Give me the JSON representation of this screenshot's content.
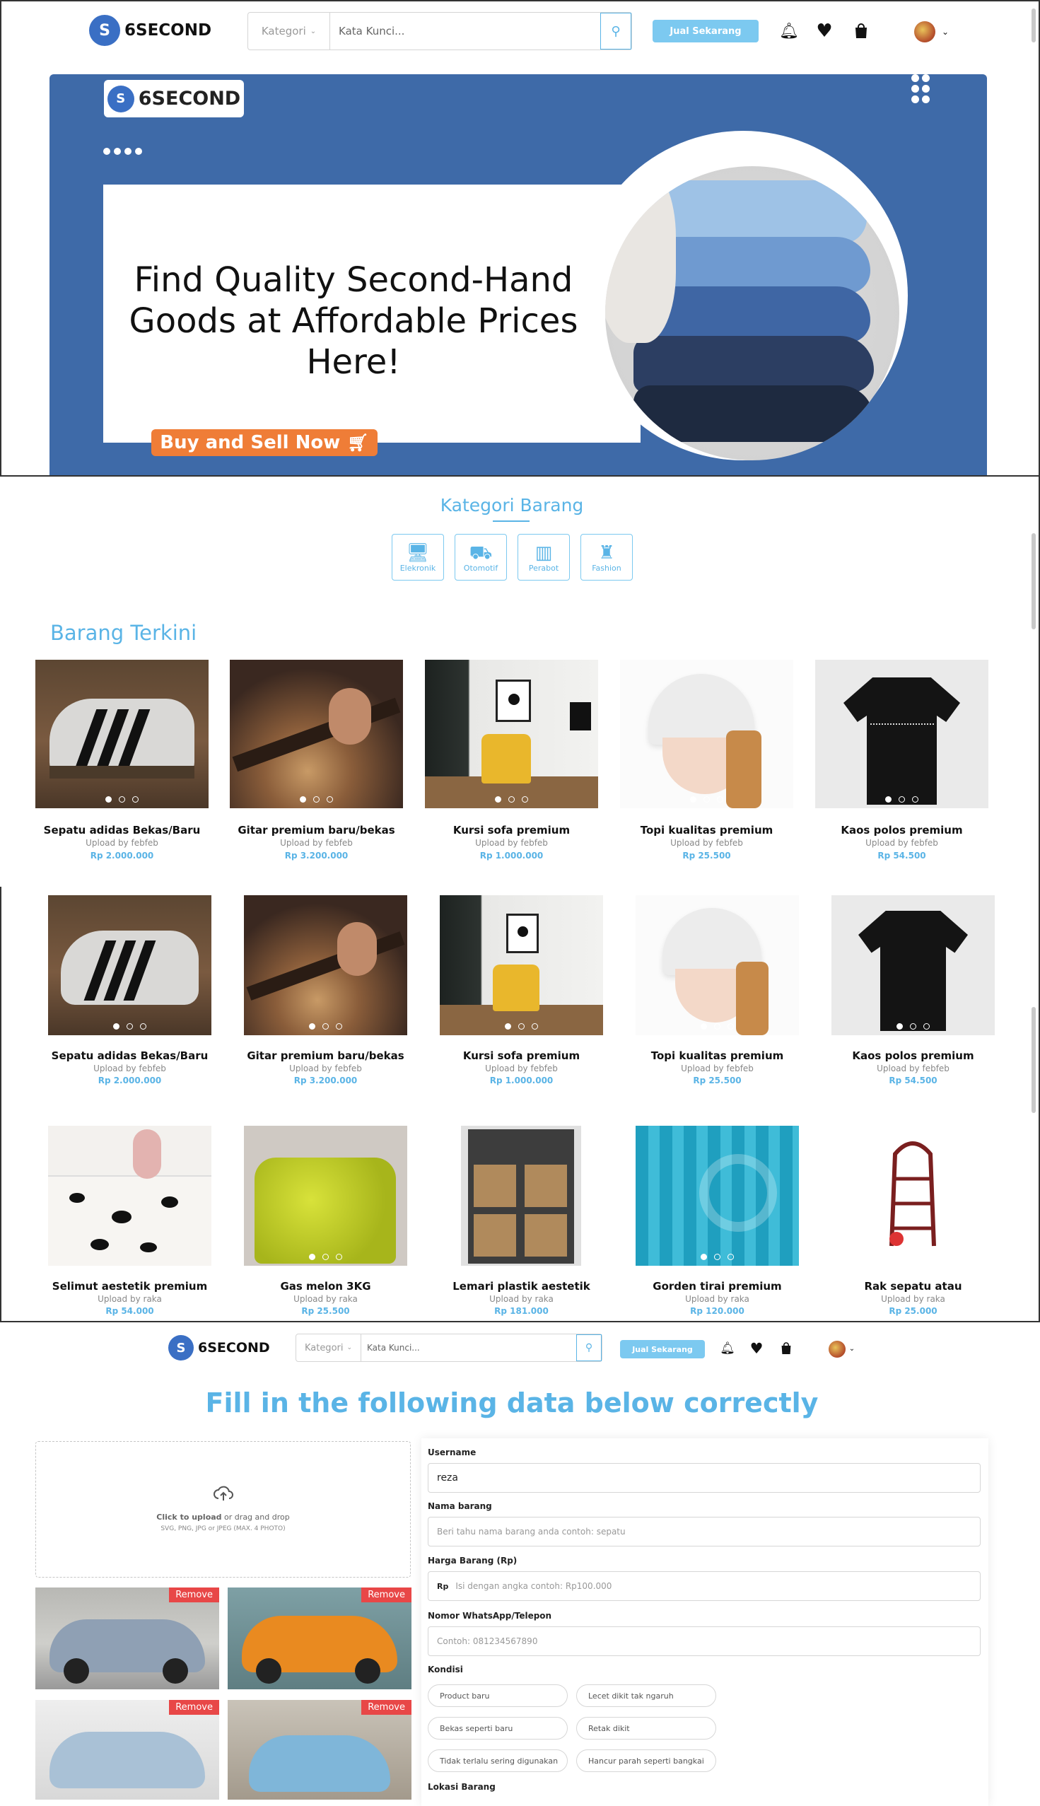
{
  "navbar": {
    "brand": "6SECOND",
    "category_placeholder": "Kategori",
    "keyword_placeholder": "Kata Kunci...",
    "sell_label": "Jual Sekarang"
  },
  "hero": {
    "logo_text": "6SECOND",
    "title": "Find Quality Second-Hand Goods at Affordable Prices Here!",
    "cta": "Buy and Sell Now"
  },
  "categories": {
    "title": "Kategori Barang",
    "items": [
      {
        "label": "Elekronik",
        "icon": "monitor-icon"
      },
      {
        "label": "Otomotif",
        "icon": "truck-icon"
      },
      {
        "label": "Perabot",
        "icon": "furniture-icon"
      },
      {
        "label": "Fashion",
        "icon": "shirt-icon"
      }
    ]
  },
  "latest": {
    "title": "Barang Terkini",
    "products": [
      {
        "name": "Sepatu adidas Bekas/Baru",
        "uploader": "Upload by febfeb",
        "price": "Rp 2.000.000"
      },
      {
        "name": "Gitar premium baru/bekas",
        "uploader": "Upload by febfeb",
        "price": "Rp 3.200.000"
      },
      {
        "name": "Kursi sofa premium",
        "uploader": "Upload by febfeb",
        "price": "Rp 1.000.000"
      },
      {
        "name": "Topi kualitas premium",
        "uploader": "Upload by febfeb",
        "price": "Rp 25.500"
      },
      {
        "name": "Kaos polos premium",
        "uploader": "Upload by febfeb",
        "price": "Rp 54.500"
      }
    ],
    "more_products": [
      {
        "name": "Selimut aestetik premium",
        "uploader": "Upload by raka",
        "price": "Rp 54.000"
      },
      {
        "name": "Gas melon 3KG",
        "uploader": "Upload by raka",
        "price": "Rp 25.500"
      },
      {
        "name": "Lemari plastik aestetik",
        "uploader": "Upload by raka",
        "price": "Rp 181.000"
      },
      {
        "name": "Gorden tirai premium",
        "uploader": "Upload by raka",
        "price": "Rp 120.000"
      },
      {
        "name": "Rak sepatu atau",
        "uploader": "Upload by raka",
        "price": "Rp 25.000"
      }
    ]
  },
  "form": {
    "title": "Fill in the following data below correctly",
    "upload": {
      "strong": "Click to upload",
      "rest": " or drag and drop",
      "hint": "SVG, PNG, JPG or JPEG (MAX. 4 PHOTO)"
    },
    "remove_label": "Remove",
    "username_label": "Username",
    "username_value": "reza",
    "item_name_label": "Nama barang",
    "item_name_placeholder": "Beri tahu nama barang anda contoh: sepatu",
    "price_label": "Harga Barang (Rp)",
    "price_prefix": "Rp",
    "price_placeholder": "Isi dengan angka contoh: Rp100.000",
    "phone_label": "Nomor WhatsApp/Telepon",
    "phone_placeholder": "Contoh: 081234567890",
    "condition_label": "Kondisi",
    "conditions": [
      "Product baru",
      "Lecet dikit tak ngaruh",
      "Bekas seperti baru",
      "Retak dikit",
      "Tidak terlalu sering digunakan",
      "Hancur parah seperti bangkai"
    ],
    "location_label": "Lokasi Barang"
  },
  "colors": {
    "accent": "#5ab4e6",
    "hero_blue": "#3e6aa8",
    "cta_orange": "#ef7d37",
    "remove_red": "#e84747"
  }
}
